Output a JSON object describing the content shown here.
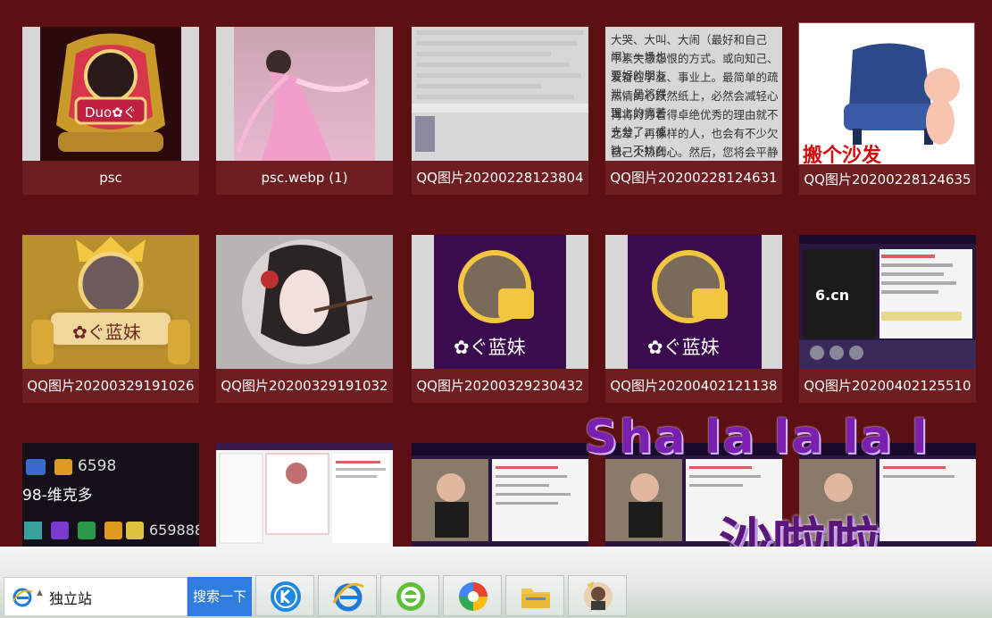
{
  "files": [
    {
      "name": "psc"
    },
    {
      "name": "psc.webp (1)"
    },
    {
      "name": "QQ图片20200228123804"
    },
    {
      "name": "QQ图片20200228124631"
    },
    {
      "name": "QQ图片20200228124635"
    },
    {
      "name": "QQ图片20200329191026"
    },
    {
      "name": "QQ图片20200329191032"
    },
    {
      "name": "QQ图片20200329230432"
    },
    {
      "name": "QQ图片20200402121138"
    },
    {
      "name": "QQ图片20200402125510"
    }
  ],
  "thumb_text": {
    "duo_badge": "Duo✿ぐ",
    "lanmei": "✿ぐ蓝妹",
    "lanmei2": "✿ぐ蓝妹",
    "sofa": "搬个沙发",
    "doc_line1": "大哭、大叫、大闹（最好和自己闹）一场也",
    "doc_line2": "平素失意怨恨的方式。或向知己、要好的朋友",
    "doc_line3": "发奋在学业、事业上。最简单的疏泄，是将得",
    "doc_line4": "热情的心跃然纸上，必然会减轻心理上的痛苦",
    "doc_line5": "再将对方看得卓绝优秀的理由就不充分了。或",
    "doc_line6": "之辈，再像样的人，也会有不少欠缺。不妨在",
    "doc_line7": "自己火热的心。然后，您将会平静下来，想到",
    "level1": "6598",
    "username": "98-维克多",
    "level2": "659888",
    "six_cn": "6.cn"
  },
  "overlay": {
    "title": "Sha la la la l",
    "sub": "沙啦啦"
  },
  "taskbar": {
    "search_value": "独立站",
    "search_button": "搜索一下"
  },
  "colors": {
    "background": "#5c1013",
    "caption_bg": "#6e1d20",
    "search_button": "#2f7de1"
  }
}
